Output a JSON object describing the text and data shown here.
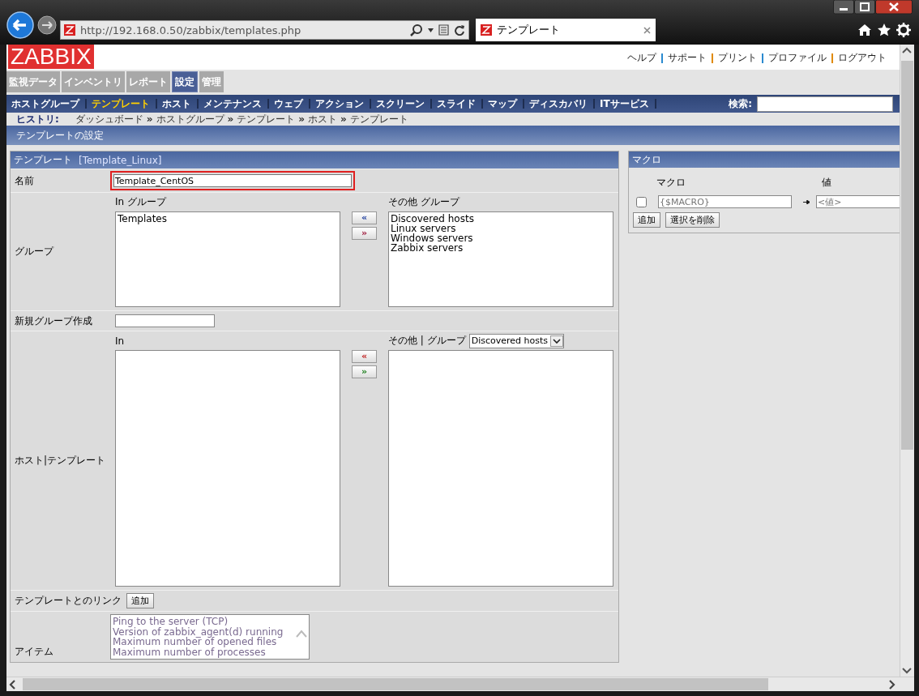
{
  "browser": {
    "url": "http://192.168.0.50/zabbix/templates.php",
    "tab_title": "テンプレート"
  },
  "header": {
    "logo": "ZABBIX",
    "links": [
      "ヘルプ",
      "サポート",
      "プリント",
      "プロファイル",
      "ログアウト"
    ]
  },
  "main_tabs": [
    {
      "label": "監視データ",
      "selected": false
    },
    {
      "label": "インベントリ",
      "selected": false
    },
    {
      "label": "レポート",
      "selected": false
    },
    {
      "label": "設定",
      "selected": true
    },
    {
      "label": "管理",
      "selected": false
    }
  ],
  "sub_nav": {
    "items": [
      {
        "label": "ホストグループ",
        "selected": false
      },
      {
        "label": "テンプレート",
        "selected": true
      },
      {
        "label": "ホスト",
        "selected": false
      },
      {
        "label": "メンテナンス",
        "selected": false
      },
      {
        "label": "ウェブ",
        "selected": false
      },
      {
        "label": "アクション",
        "selected": false
      },
      {
        "label": "スクリーン",
        "selected": false
      },
      {
        "label": "スライド",
        "selected": false
      },
      {
        "label": "マップ",
        "selected": false
      },
      {
        "label": "ディスカバリ",
        "selected": false
      },
      {
        "label": "ITサービス",
        "selected": false
      }
    ],
    "search_label": "検索:"
  },
  "history": {
    "label": "ヒストリ:",
    "separator": "»",
    "items": [
      "ダッシュボード",
      "ホストグループ",
      "テンプレート",
      "ホスト",
      "テンプレート"
    ]
  },
  "page_title": "テンプレートの設定",
  "form": {
    "title": "テンプレート",
    "subtitle": "[Template_Linux]",
    "name": {
      "label": "名前",
      "value": "Template_CentOS",
      "highlighted": true
    },
    "groups": {
      "label": "グループ",
      "in_title": "In グループ",
      "in_items": [
        "Templates"
      ],
      "other_title": "その他 グループ",
      "other_items": [
        "Discovered hosts",
        "Linux servers",
        "Windows servers",
        "Zabbix servers"
      ],
      "move_left": "«",
      "move_right": "»"
    },
    "new_group": {
      "label": "新規グループ作成"
    },
    "hosts": {
      "label": "ホスト|テンプレート",
      "in_title": "In",
      "other_title": "その他 | グループ",
      "group_select": "Discovered hosts",
      "move_left": "«",
      "move_right": "»"
    },
    "linked": {
      "label": "テンプレートとのリンク",
      "button": "追加"
    },
    "items": {
      "label": "アイテム",
      "entries": [
        "Ping to the server (TCP)",
        "Version of zabbix_agent(d) running",
        "Maximum number of opened files",
        "Maximum number of processes"
      ]
    }
  },
  "macros": {
    "title": "マクロ",
    "col_macro": "マクロ",
    "col_value": "値",
    "rows": [
      {
        "checked": false,
        "macro_placeholder": "{$MACRO}",
        "value_placeholder": "<値>"
      }
    ],
    "buttons": [
      "追加",
      "選択を削除"
    ]
  }
}
